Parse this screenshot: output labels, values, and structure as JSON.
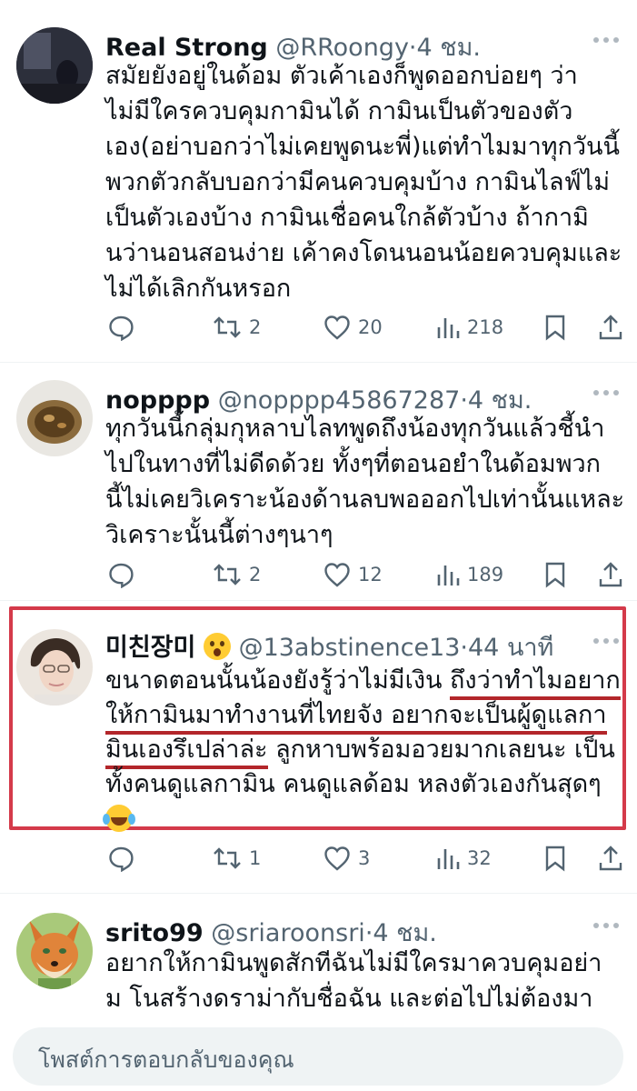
{
  "tweets": [
    {
      "name": "Real Strong",
      "handle": "@RRoongy",
      "time": "4 ชม.",
      "lines": [
        "สมัยยังอยู่ในด้อม ตัวเค้าเองก็พูดออกบ่อยๆ ว่า",
        "ไม่มีใครควบคุมกามินได้ กามินเป็นตัวของตัว",
        "เอง(อย่าบอกว่าไม่เคยพูดนะพี่)แต่ทำไมมาทุกวันนี้",
        "พวกตัวกลับบอกว่ามีคนควบคุมบ้าง กามินไลฟ์ไม่",
        "เป็นตัวเองบ้าง กามินเชื่อคนใกล้ตัวบ้าง ถ้ากามิ",
        "นว่านอนสอนง่าย เค้าคงโดนนอนน้อยควบคุมและ",
        "ไม่ได้เลิกกันหรอก"
      ],
      "retweets": "2",
      "likes": "20",
      "views": "218"
    },
    {
      "name": "nopppp",
      "handle": "@nopppp45867287",
      "time": "4 ชม.",
      "lines": [
        "ทุกวันนี้กลุ่มกุหลาบไลทพูดถึงน้องทุกวันแล้วชี้นำ",
        "ไปในทางที่ไม่ดีดด้วย  ทั้งๆที่ตอนอยำในด้อมพวก",
        "นี้ไม่เคยวิเคราะน้องด้านลบพอออกไปเท่านั้นแหละ",
        "วิเคราะนั้นนี้ต่างๆนาๆ"
      ],
      "retweets": "2",
      "likes": "12",
      "views": "189"
    },
    {
      "name": "미친장미",
      "handle": "@13abstinence13",
      "time": "44 นาที",
      "line1_a": "ขนาดตอนนั้นน้องยังรู้ว่าไม่มีเงิน ",
      "line1_b": "ถึงว่าทำไมอยาก",
      "line2": "ให้กามินมาทำงานที่ไทยจัง อยากจะเป็นผู้ดูแลกา",
      "line3_a": "มินเองรึเปล่าล่ะ",
      "line3_b": " ลูกหาบพร้อมอวยมากเลยนะ เป็น",
      "line4": "ทั้งคนดูแลกามิน คนดูแลด้อม หลงตัวเองกันสุดๆ",
      "retweets": "1",
      "likes": "3",
      "views": "32"
    },
    {
      "name": "srito99",
      "handle": "@sriaroonsri",
      "time": "4 ชม.",
      "lines": [
        "อยากให้กามินพูดสักทีฉันไม่มีใครมาควบคุมอย่า",
        "ม โนสร้างดราม่ากับชื่อฉัน และต่อไปไม่ต้องมา"
      ]
    }
  ],
  "reply": {
    "placeholder": "โพสต์การตอบกลับของคุณ"
  }
}
